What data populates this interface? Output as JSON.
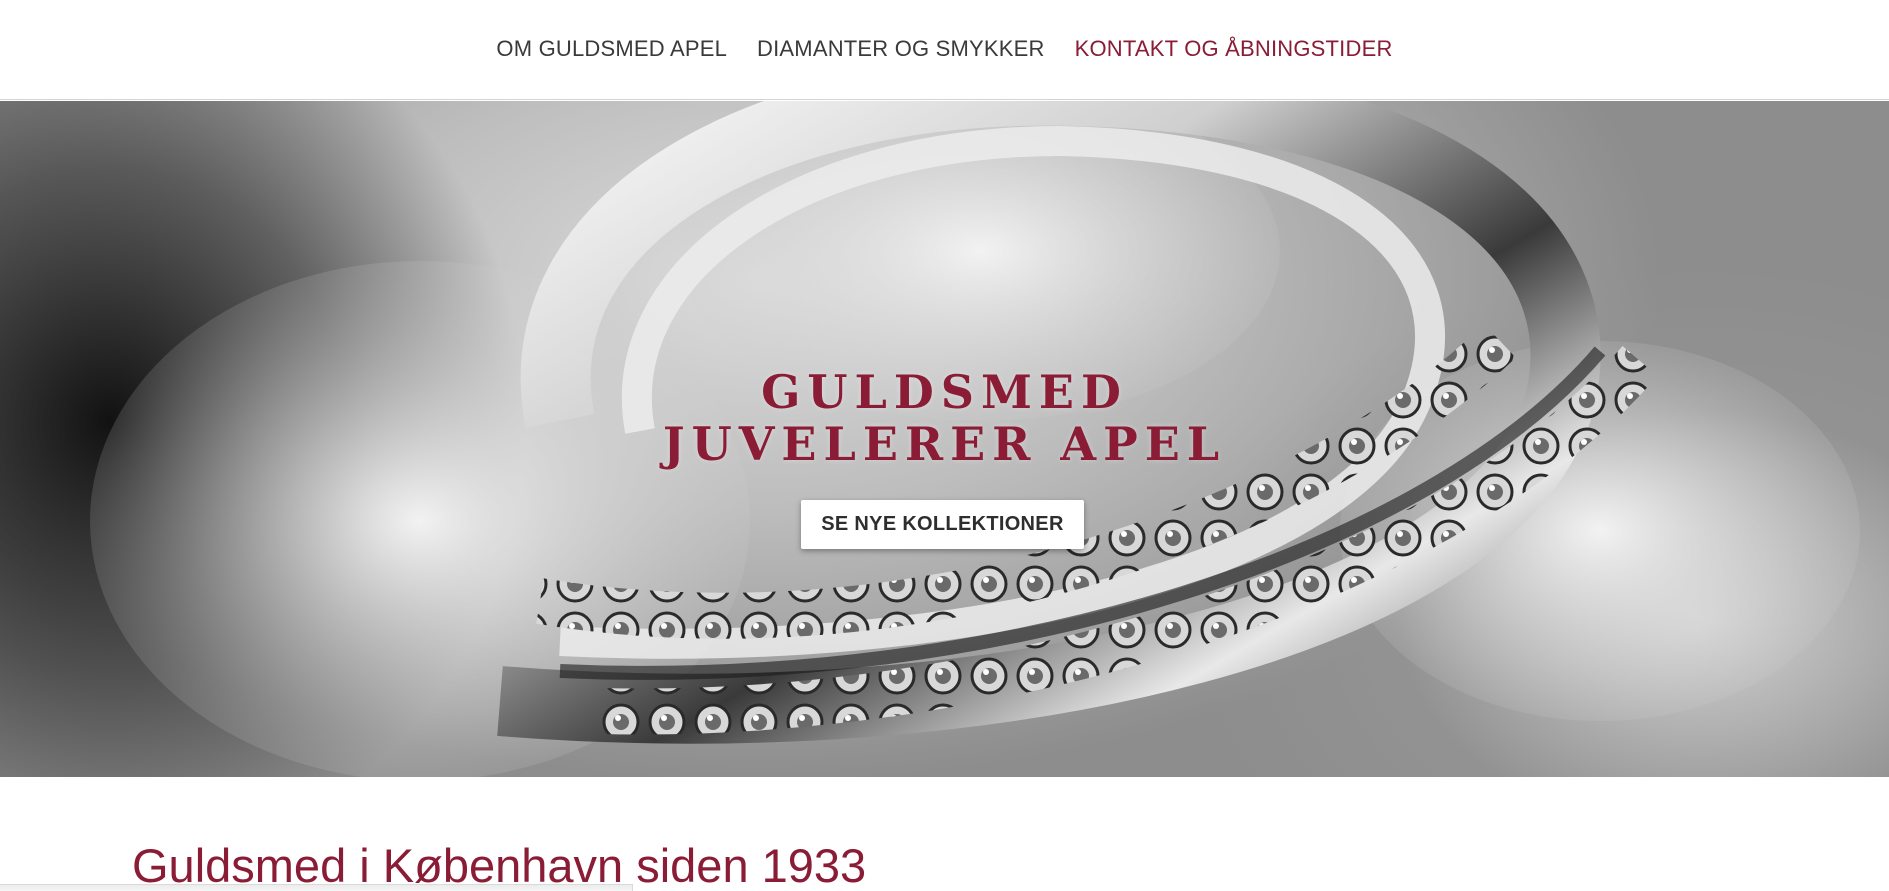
{
  "nav": {
    "items": [
      {
        "label": "OM GULDSMED APEL"
      },
      {
        "label": "DIAMANTER OG SMYKKER"
      },
      {
        "label": "KONTAKT OG ÅBNINGSTIDER"
      }
    ],
    "active_color": "#8a1c35"
  },
  "hero": {
    "title_line1": "GULDSMED",
    "title_line2": "JUVELERER APEL",
    "button_label": "SE NYE KOLLEKTIONER",
    "image_subject": "silver-diamond-rings-on-rose"
  },
  "content": {
    "heading": "Guldsmed i København siden 1933"
  },
  "colors": {
    "brand": "#8a1c35",
    "nav_text": "#3a3a3a"
  }
}
